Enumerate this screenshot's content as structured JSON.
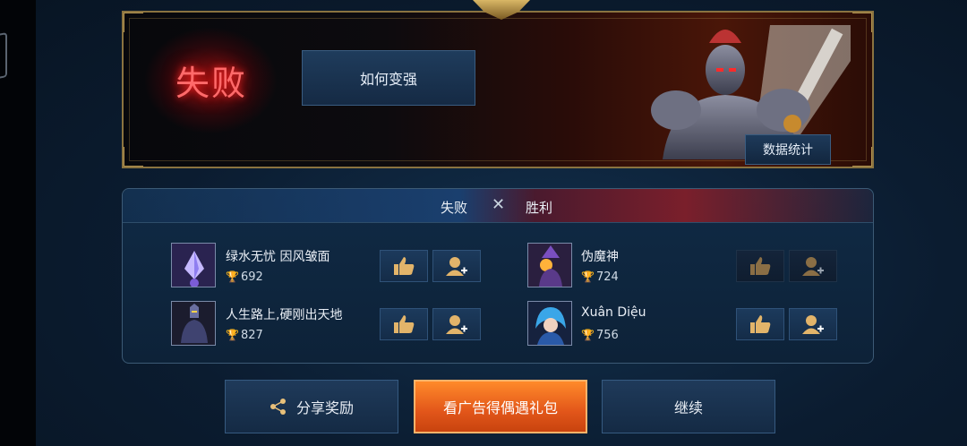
{
  "banner": {
    "result_label": "失败",
    "improve_button": "如何变强",
    "stats_button": "数据统计"
  },
  "panel": {
    "defeat_label": "失败",
    "vs_symbol": "✕",
    "victory_label": "胜利",
    "left_team": [
      {
        "name": "绿水无忧 因风皱面",
        "score": "692"
      },
      {
        "name": "人生路上,硬刚出天地",
        "score": "827"
      }
    ],
    "right_team": [
      {
        "name": "伪魔神",
        "score": "724"
      },
      {
        "name": "Xuân Diệu",
        "score": "756"
      }
    ]
  },
  "bottom": {
    "share_label": "分享奖励",
    "ad_label": "看广告得偶遇礼包",
    "continue_label": "继续"
  },
  "colors": {
    "defeat_red": "#ff6a6a",
    "ad_orange": "#e2561a",
    "trophy_gold": "#e8b43a"
  }
}
